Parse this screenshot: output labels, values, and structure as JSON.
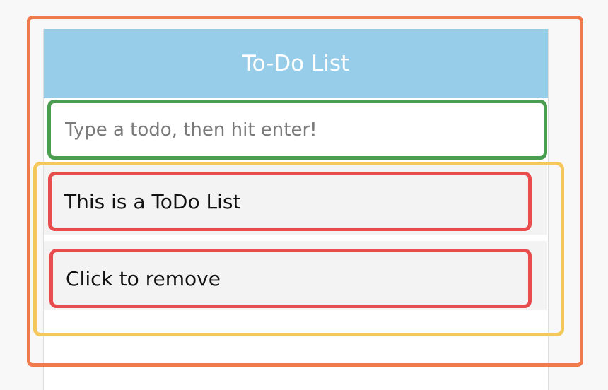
{
  "app": {
    "title": "To-Do List"
  },
  "input": {
    "placeholder": "Type a todo, then hit enter!",
    "value": ""
  },
  "todos": [
    {
      "label": "This is a ToDo List"
    },
    {
      "label": "Click to remove"
    }
  ],
  "colors": {
    "header_bg": "#97cde8",
    "app_highlight": "#ee7a4e",
    "input_highlight": "#4a9e4f",
    "list_highlight": "#f5c85c",
    "item_highlight": "#e84c4c",
    "item_bg": "#f3f3f3"
  }
}
